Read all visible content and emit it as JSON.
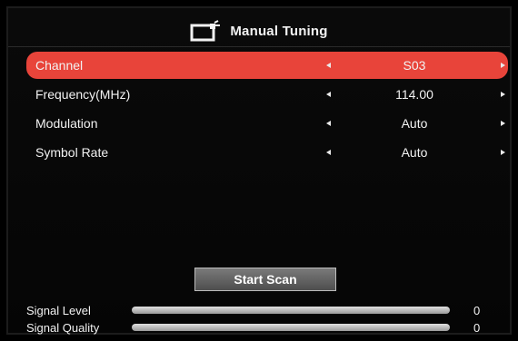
{
  "header": {
    "title": "Manual Tuning",
    "icon": "tv-icon"
  },
  "menu": [
    {
      "label": "Channel",
      "value": "S03",
      "selected": true
    },
    {
      "label": "Frequency(MHz)",
      "value": "114.00",
      "selected": false
    },
    {
      "label": "Modulation",
      "value": "Auto",
      "selected": false
    },
    {
      "label": "Symbol Rate",
      "value": "Auto",
      "selected": false
    }
  ],
  "scan_button": {
    "label": "Start Scan"
  },
  "signal": {
    "level": {
      "label": "Signal Level",
      "value": "0",
      "fraction": 0
    },
    "quality": {
      "label": "Signal Quality",
      "value": "0",
      "fraction": 0
    }
  },
  "colors": {
    "highlight": "#e8443a",
    "meter": "#5fc24a"
  }
}
